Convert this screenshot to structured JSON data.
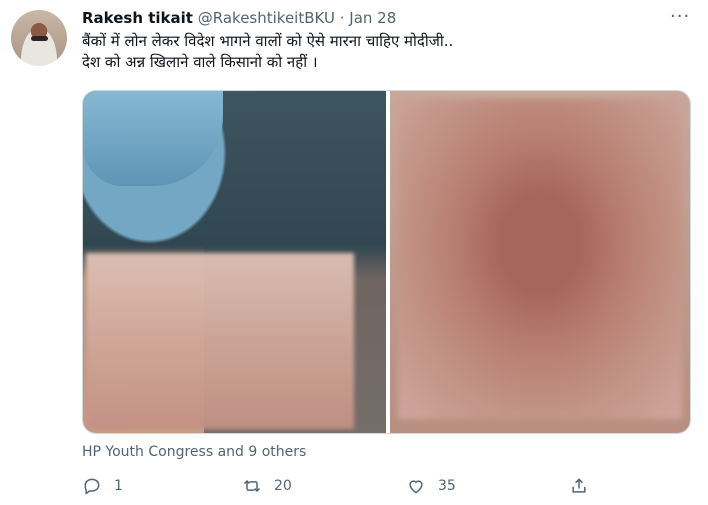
{
  "tweet": {
    "author_name": "Rakesh tikait",
    "handle": "@RakeshtikeitBKU",
    "separator": "·",
    "date": "Jan 28",
    "more_label": "···",
    "text_line1": "बैंकों में लोन लेकर विदेश भागने वालों को ऐसे मारना चाहिए मोदीजी..",
    "text_line2": "देश को अन्न खिलाने वाले किसानो को नहीं ।",
    "liked_by": "HP Youth Congress and 9 others",
    "actions": {
      "reply_count": "1",
      "retweet_count": "20",
      "like_count": "35"
    },
    "icons": [
      "reply-icon",
      "retweet-icon",
      "like-icon",
      "share-icon",
      "more-icon"
    ],
    "colors": {
      "text_primary": "#0f1419",
      "text_secondary": "#536471",
      "border": "#cfd9de"
    }
  }
}
